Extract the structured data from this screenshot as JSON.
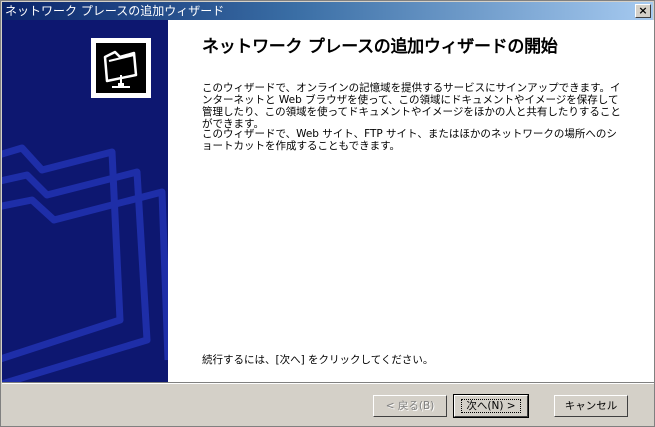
{
  "window": {
    "title": "ネットワーク プレースの追加ウィザード",
    "close_label": "×"
  },
  "banner": {
    "logo_icon": "network-folder-icon"
  },
  "main": {
    "heading": "ネットワーク プレースの追加ウィザードの開始",
    "paragraph1": "このウィザードで、オンラインの記憶域を提供するサービスにサインアップできます。インターネットと Web ブラウザを使って、この領域にドキュメントやイメージを保存して管理したり、この領域を使ってドキュメントやイメージをほかの人と共有したりすることができます。",
    "paragraph2": "このウィザードで、Web サイト、FTP サイト、またはほかのネットワークの場所へのショートカットを作成することもできます。",
    "footer_text": "続行するには、[次へ] をクリックしてください。"
  },
  "buttons": {
    "back": "< 戻る(B)",
    "next": "次へ(N) >",
    "cancel": "キャンセル"
  },
  "colors": {
    "banner_bg": "#0d1770",
    "title_start": "#0a246a",
    "title_end": "#a6caf0"
  }
}
